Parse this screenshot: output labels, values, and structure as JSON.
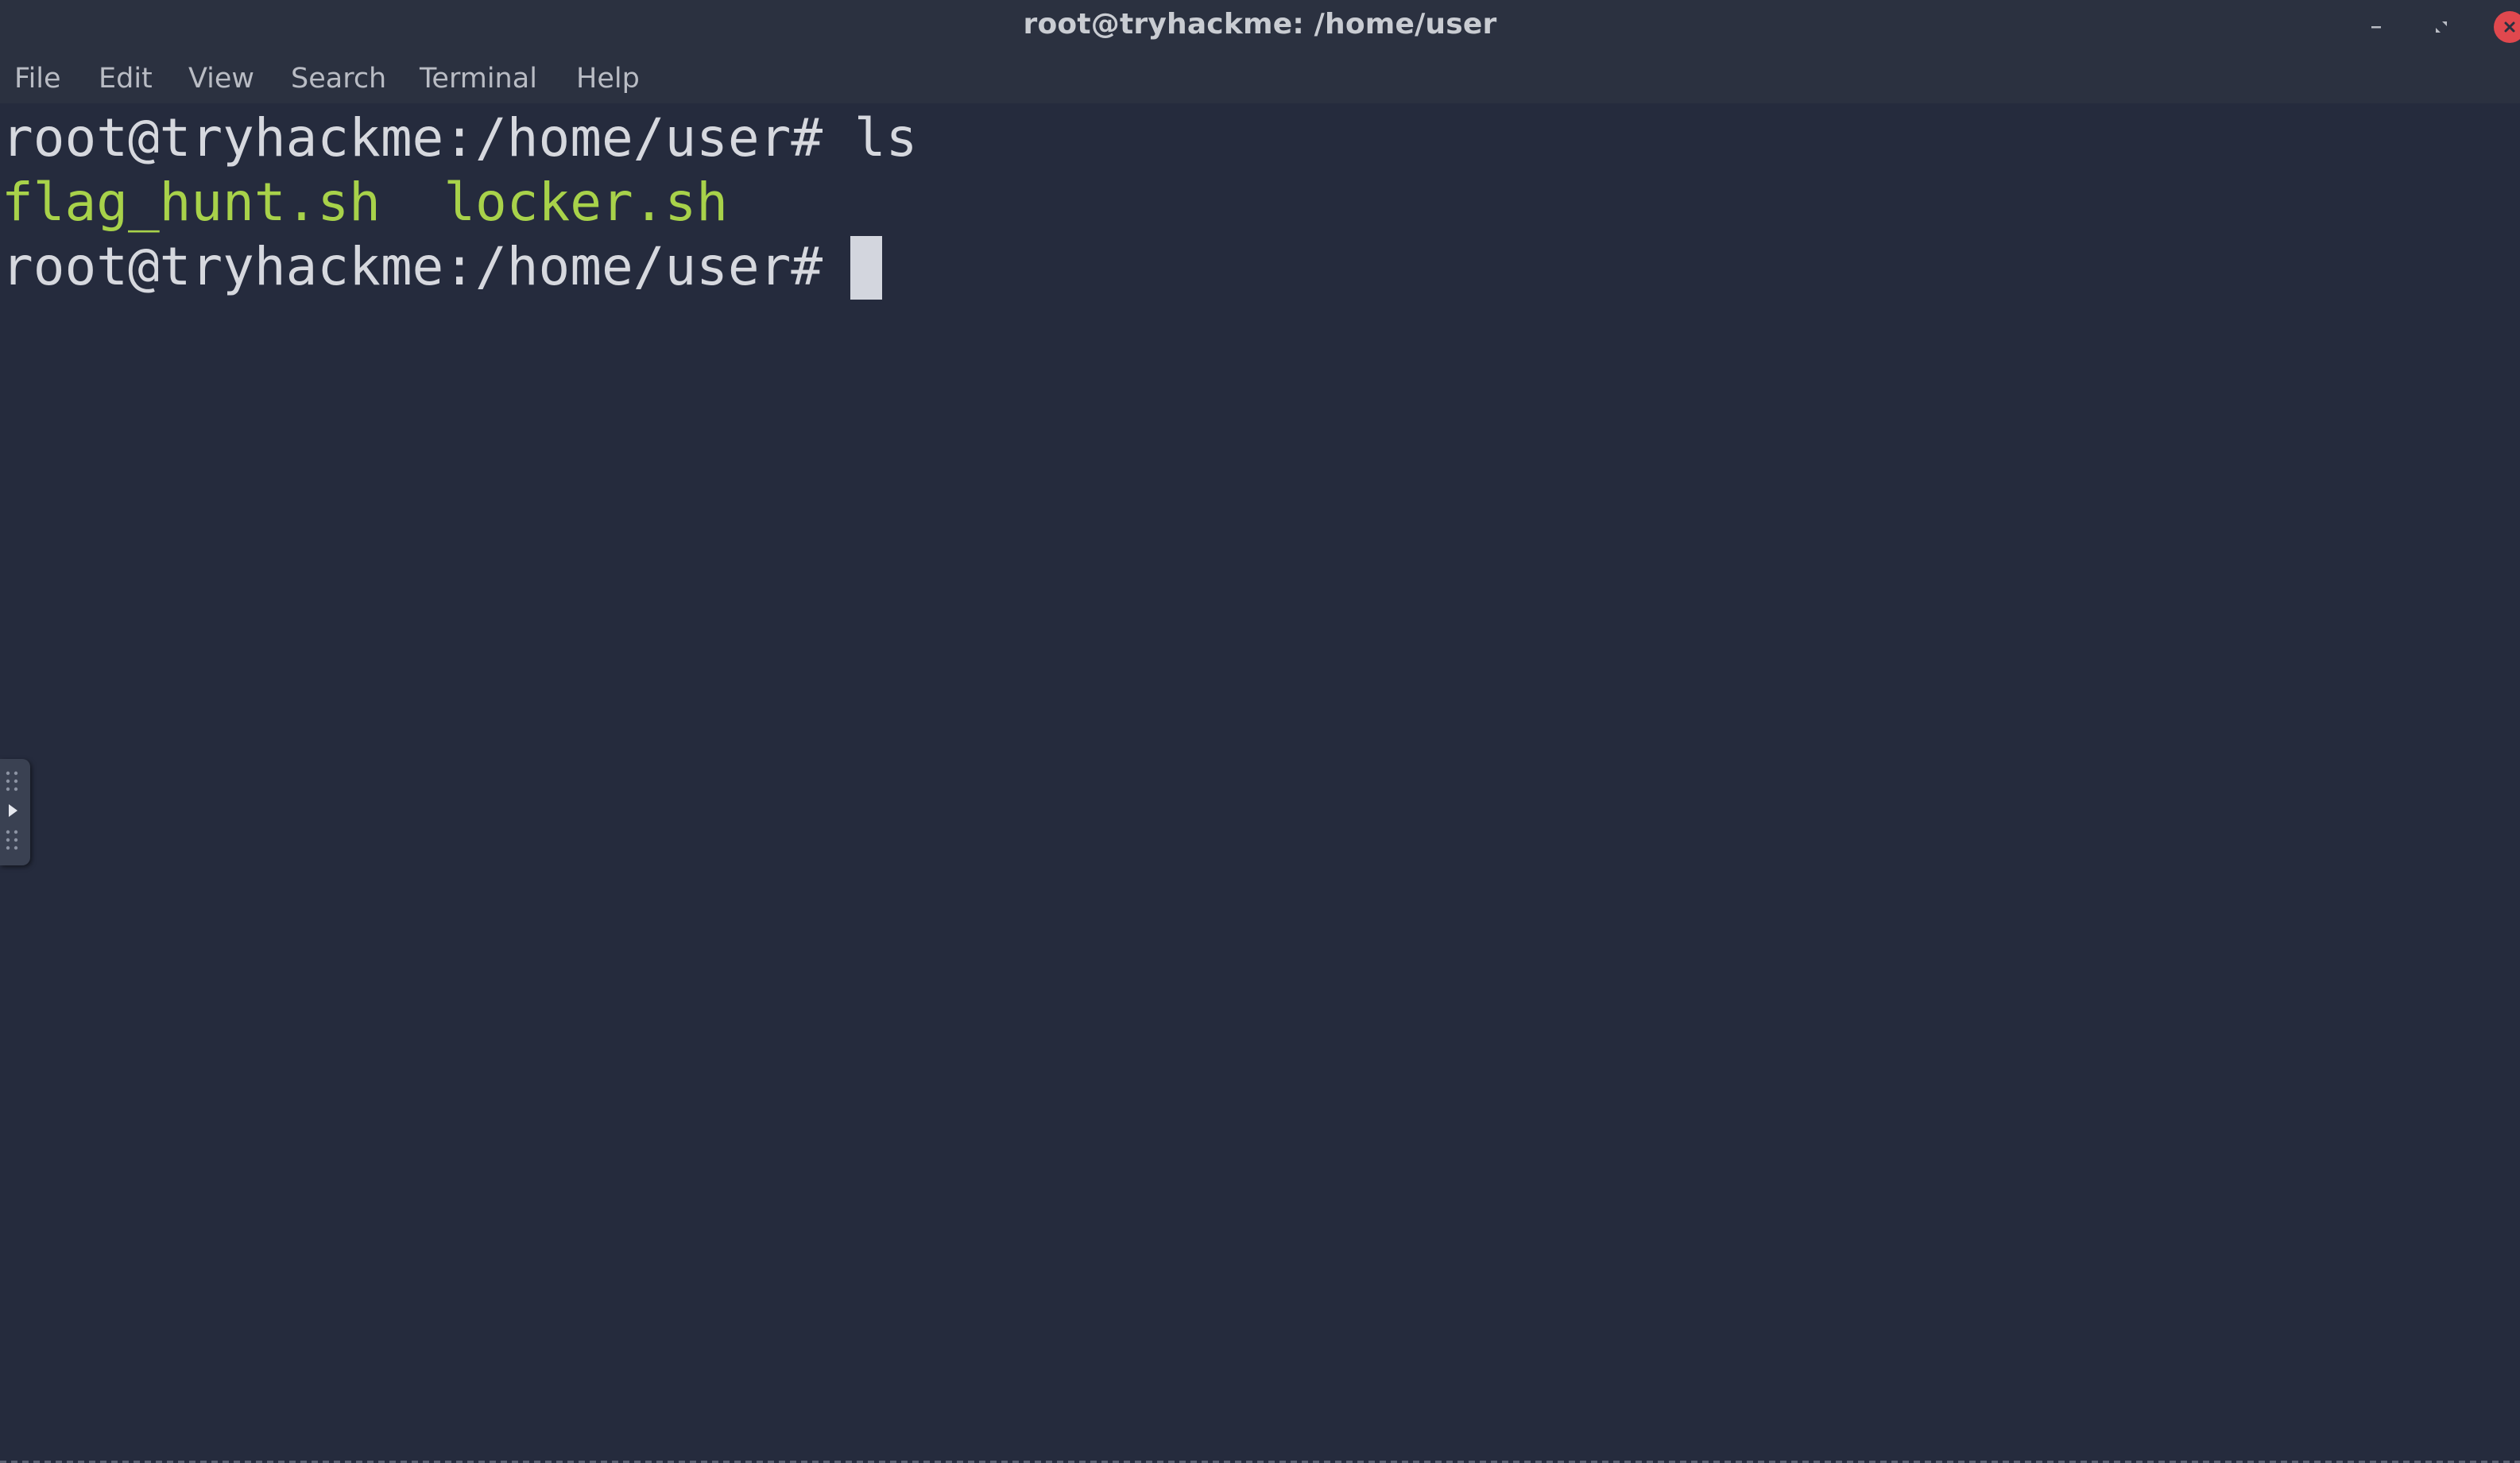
{
  "window": {
    "title": "root@tryhackme: /home/user"
  },
  "menu": {
    "file": "File",
    "edit": "Edit",
    "view": "View",
    "search": "Search",
    "terminal": "Terminal",
    "help": "Help"
  },
  "terminal": {
    "line1": "root@tryhackme:/home/user# ls",
    "files": {
      "file1": "flag_hunt.sh",
      "separator": "  ",
      "file2": "locker.sh"
    },
    "line3": "root@tryhackme:/home/user# "
  },
  "colors": {
    "background": "#252b3d",
    "titlebar": "#2b3140",
    "prompt_text": "#d6d8de",
    "executable_files": "#a8d24a",
    "close_button": "#e0484e"
  },
  "icons": {
    "minimize": "minimize-icon",
    "maximize": "maximize-icon",
    "close": "close-icon",
    "side_handle": "play-icon"
  }
}
